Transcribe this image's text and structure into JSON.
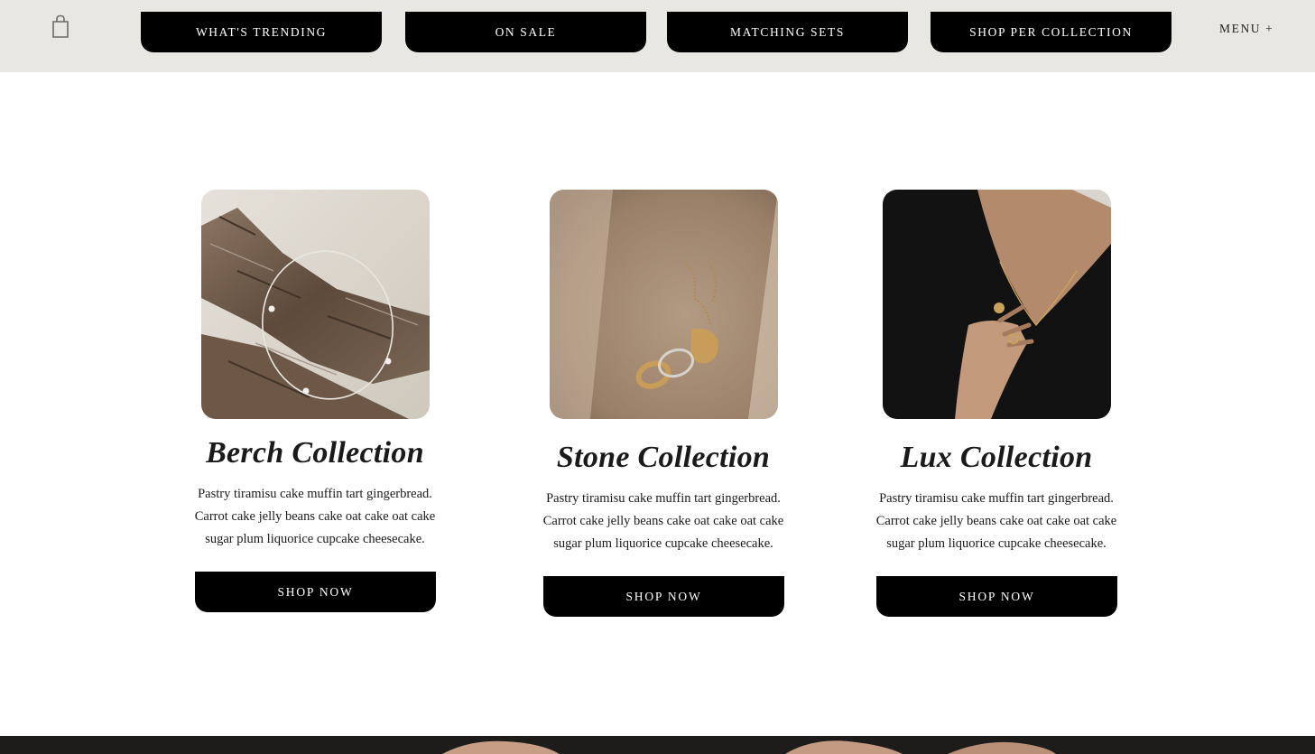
{
  "header": {
    "cart_icon": "shopping-bag-icon",
    "nav": [
      {
        "label": "WHAT'S TRENDING"
      },
      {
        "label": "ON SALE"
      },
      {
        "label": "MATCHING SETS"
      },
      {
        "label": "SHOP PER COLLECTION"
      }
    ],
    "menu_label": "MENU +"
  },
  "collections": [
    {
      "title": "Berch Collection",
      "description": "Pastry tiramisu cake muffin tart gingerbread. Carrot cake jelly beans cake oat cake oat cake sugar plum liquorice cupcake cheesecake.",
      "button_label": "SHOP NOW",
      "image": "driftwood-necklace-photo"
    },
    {
      "title": "Stone Collection",
      "description": "Pastry tiramisu cake muffin tart gingerbread. Carrot cake jelly beans cake oat cake oat cake sugar plum liquorice cupcake cheesecake.",
      "button_label": "SHOP NOW",
      "image": "stone-rings-photo"
    },
    {
      "title": "Lux Collection",
      "description": "Pastry tiramisu cake muffin tart gingerbread. Carrot cake jelly beans cake oat cake oat cake sugar plum liquorice cupcake cheesecake.",
      "button_label": "SHOP NOW",
      "image": "model-necklace-photo"
    }
  ],
  "colors": {
    "header_bg": "#e9e7e2",
    "button_bg": "#000000",
    "button_text": "#ffffff",
    "page_bg": "#ffffff"
  }
}
